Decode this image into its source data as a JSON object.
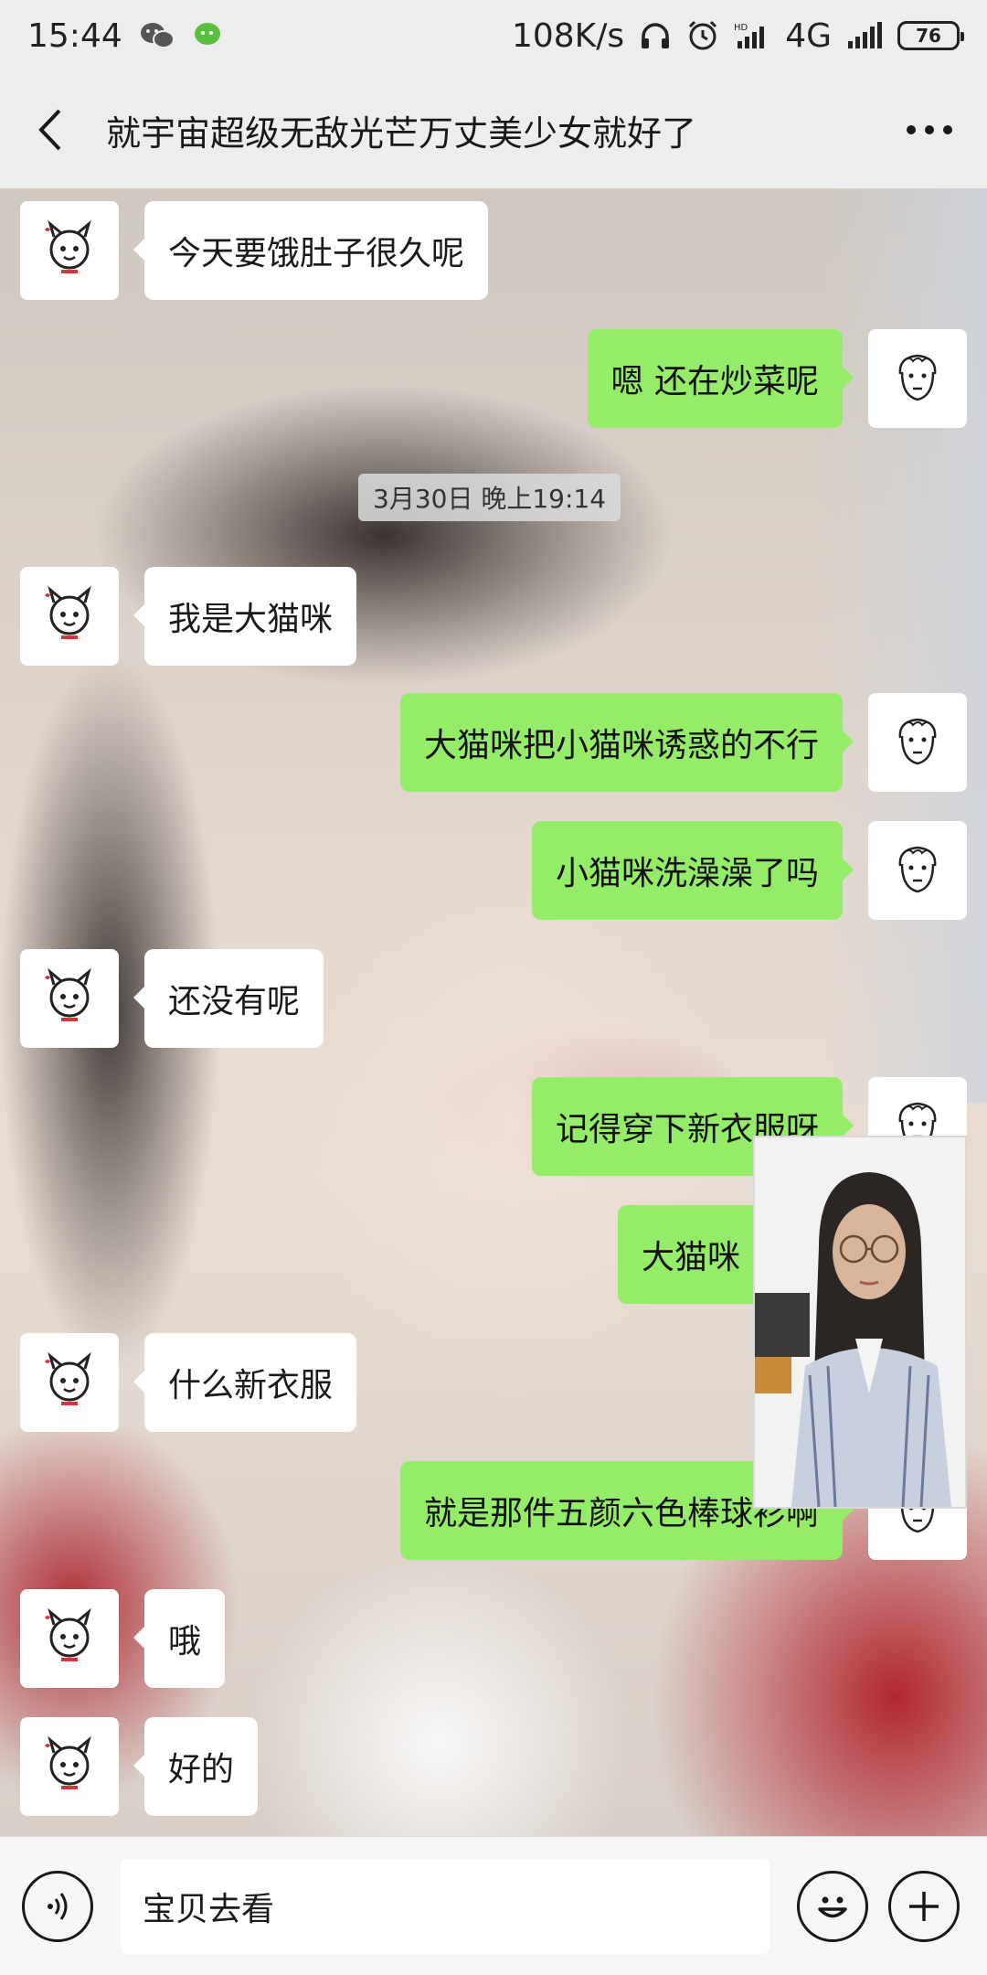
{
  "status_bar": {
    "time": "15:44",
    "speed": "108K/s",
    "network": "4G",
    "battery": "76"
  },
  "header": {
    "title": "就宇宙超级无敌光芒万丈美少女就好了"
  },
  "messages": [
    {
      "side": "left",
      "text": "今天要饿肚子很久呢"
    },
    {
      "side": "right",
      "text": "嗯 还在炒菜呢"
    },
    {
      "side": "left",
      "text": "我是大猫咪"
    },
    {
      "side": "right",
      "text": "大猫咪把小猫咪诱惑的不行"
    },
    {
      "side": "right",
      "text": "小猫咪洗澡澡了吗"
    },
    {
      "side": "left",
      "text": "还没有呢"
    },
    {
      "side": "right",
      "text": "记得穿下新衣服呀"
    },
    {
      "side": "right",
      "text": "大猫咪"
    },
    {
      "side": "left",
      "text": "什么新衣服"
    },
    {
      "side": "right",
      "text": "就是那件五颜六色棒球衫啊"
    },
    {
      "side": "left",
      "text": "哦"
    },
    {
      "side": "left",
      "text": "好的"
    }
  ],
  "timestamp": "3月30日 晚上19:14",
  "input": {
    "value": "宝贝去看"
  },
  "colors": {
    "accent_green": "#95ec69",
    "background": "#ededed"
  },
  "icons": [
    "back-arrow-icon",
    "more-icon",
    "voice-icon",
    "emoji-icon",
    "plus-icon",
    "wechat-icon",
    "headphones-icon",
    "alarm-icon",
    "signal-icon"
  ]
}
